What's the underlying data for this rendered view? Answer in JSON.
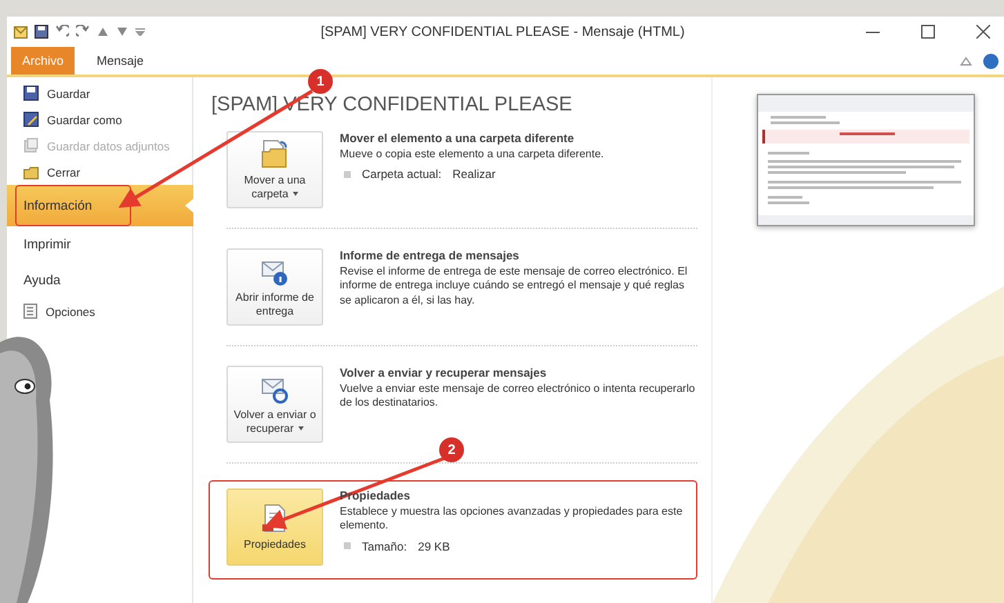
{
  "window": {
    "title": "[SPAM] VERY CONFIDENTIAL PLEASE  -  Mensaje (HTML)"
  },
  "tabs": [
    {
      "label": "Archivo",
      "selected": true
    },
    {
      "label": "Mensaje",
      "selected": false
    }
  ],
  "sidebar": {
    "items": [
      {
        "label": "Guardar",
        "kind": "command",
        "disabled": false,
        "selected": false
      },
      {
        "label": "Guardar como",
        "kind": "command",
        "disabled": false,
        "selected": false
      },
      {
        "label": "Guardar datos adjuntos",
        "kind": "command",
        "disabled": true,
        "selected": false
      },
      {
        "label": "Cerrar",
        "kind": "command",
        "disabled": false,
        "selected": false
      },
      {
        "label": "Información",
        "kind": "page",
        "disabled": false,
        "selected": true
      },
      {
        "label": "Imprimir",
        "kind": "page",
        "disabled": false,
        "selected": false
      },
      {
        "label": "Ayuda",
        "kind": "page",
        "disabled": false,
        "selected": false
      },
      {
        "label": "Opciones",
        "kind": "command",
        "disabled": false,
        "selected": false
      }
    ]
  },
  "content": {
    "heading": "[SPAM] VERY CONFIDENTIAL PLEASE",
    "sections": [
      {
        "button_label": "Mover a una carpeta",
        "dropdown": true,
        "highlighted": false,
        "title": "Mover el elemento a una carpeta diferente",
        "description": "Mueve o copia este elemento a una carpeta diferente.",
        "details": [
          {
            "label": "Carpeta actual:",
            "value": "Realizar"
          }
        ]
      },
      {
        "button_label": "Abrir informe de entrega",
        "dropdown": false,
        "highlighted": false,
        "title": "Informe de entrega de mensajes",
        "description": "Revise el informe de entrega de este mensaje de correo electrónico. El informe de entrega incluye cuándo se entregó el mensaje y qué reglas se aplicaron a él, si las hay."
      },
      {
        "button_label": "Volver a enviar o recuperar",
        "dropdown": true,
        "highlighted": false,
        "title": "Volver a enviar y recuperar mensajes",
        "description": "Vuelve a enviar este mensaje de correo electrónico o intenta recuperarlo de los destinatarios."
      },
      {
        "button_label": "Propiedades",
        "dropdown": false,
        "highlighted": true,
        "title": "Propiedades",
        "description": "Establece y muestra las opciones avanzadas y propiedades para este elemento.",
        "details": [
          {
            "label": "Tamaño:",
            "value": "29 KB"
          }
        ]
      }
    ]
  },
  "annotations": [
    {
      "number": "1"
    },
    {
      "number": "2"
    }
  ]
}
